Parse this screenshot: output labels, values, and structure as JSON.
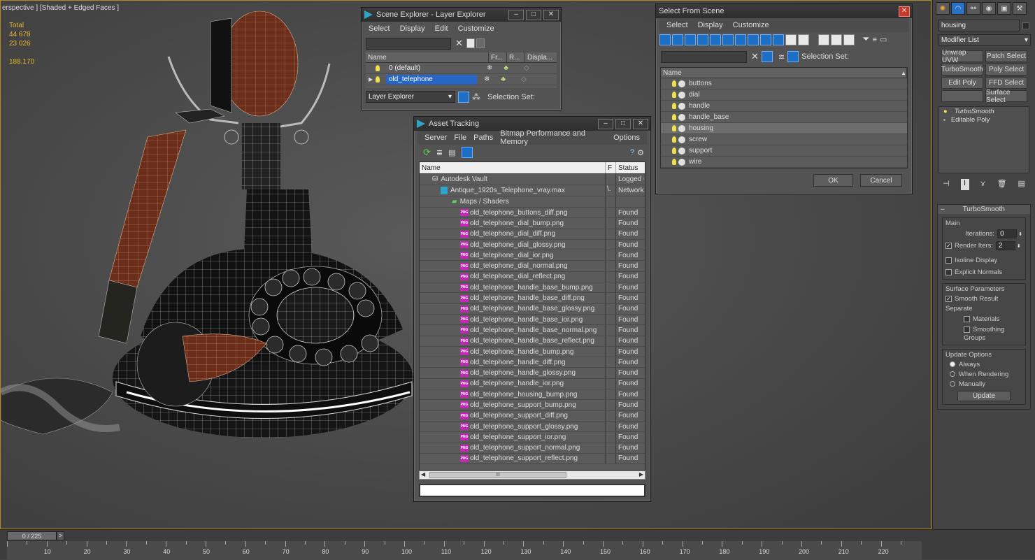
{
  "viewport": {
    "label": "erspective ] [Shaded + Edged Faces ]",
    "stats": {
      "total_label": "Total",
      "polys": "44 678",
      "verts": "23 026",
      "fps": "188.170"
    }
  },
  "scene_explorer": {
    "title": "Scene Explorer - Layer Explorer",
    "menu": [
      "Select",
      "Display",
      "Edit",
      "Customize"
    ],
    "columns": [
      "Name",
      "Fr...",
      "R...",
      "Displa..."
    ],
    "rows": [
      {
        "name": "0 (default)",
        "selected": false
      },
      {
        "name": "old_telephone",
        "selected": true
      }
    ],
    "dropdown": "Layer Explorer",
    "selection_set_label": "Selection Set:"
  },
  "asset_tracking": {
    "title": "Asset Tracking",
    "menu": [
      "Server",
      "File",
      "Paths",
      "Bitmap Performance and Memory",
      "Options"
    ],
    "columns": [
      "Name",
      "F",
      "Status"
    ],
    "vault": {
      "name": "Autodesk Vault",
      "status": "Logged C"
    },
    "scene_file": {
      "name": "Antique_1920s_Telephone_vray.max",
      "flag": "\\.",
      "status": "Network"
    },
    "group": "Maps / Shaders",
    "files": [
      {
        "name": "old_telephone_buttons_diff.png",
        "status": "Found"
      },
      {
        "name": "old_telephone_dial_bump.png",
        "status": "Found"
      },
      {
        "name": "old_telephone_dial_diff.png",
        "status": "Found"
      },
      {
        "name": "old_telephone_dial_glossy.png",
        "status": "Found"
      },
      {
        "name": "old_telephone_dial_ior.png",
        "status": "Found"
      },
      {
        "name": "old_telephone_dial_normal.png",
        "status": "Found"
      },
      {
        "name": "old_telephone_dial_reflect.png",
        "status": "Found"
      },
      {
        "name": "old_telephone_handle_base_bump.png",
        "status": "Found"
      },
      {
        "name": "old_telephone_handle_base_diff.png",
        "status": "Found"
      },
      {
        "name": "old_telephone_handle_base_glossy.png",
        "status": "Found"
      },
      {
        "name": "old_telephone_handle_base_ior.png",
        "status": "Found"
      },
      {
        "name": "old_telephone_handle_base_normal.png",
        "status": "Found"
      },
      {
        "name": "old_telephone_handle_base_reflect.png",
        "status": "Found"
      },
      {
        "name": "old_telephone_handle_bump.png",
        "status": "Found"
      },
      {
        "name": "old_telephone_handle_diff.png",
        "status": "Found"
      },
      {
        "name": "old_telephone_handle_glossy.png",
        "status": "Found"
      },
      {
        "name": "old_telephone_handle_ior.png",
        "status": "Found"
      },
      {
        "name": "old_telephone_housing_bump.png",
        "status": "Found"
      },
      {
        "name": "old_telephone_support_bump.png",
        "status": "Found"
      },
      {
        "name": "old_telephone_support_diff.png",
        "status": "Found"
      },
      {
        "name": "old_telephone_support_glossy.png",
        "status": "Found"
      },
      {
        "name": "old_telephone_support_ior.png",
        "status": "Found"
      },
      {
        "name": "old_telephone_support_normal.png",
        "status": "Found"
      },
      {
        "name": "old_telephone_support_reflect.png",
        "status": "Found"
      }
    ],
    "scroll_grip": "III"
  },
  "select_from_scene": {
    "title": "Select From Scene",
    "menu": [
      "Select",
      "Display",
      "Customize"
    ],
    "selection_set_label": "Selection Set:",
    "column": "Name",
    "objects": [
      {
        "name": "buttons",
        "selected": false
      },
      {
        "name": "dial",
        "selected": false
      },
      {
        "name": "handle",
        "selected": false
      },
      {
        "name": "handle_base",
        "selected": false
      },
      {
        "name": "housing",
        "selected": true
      },
      {
        "name": "screw",
        "selected": false
      },
      {
        "name": "support",
        "selected": false
      },
      {
        "name": "wire",
        "selected": false
      }
    ],
    "ok": "OK",
    "cancel": "Cancel"
  },
  "command_panel": {
    "object_name": "housing",
    "modifier_list": "Modifier List",
    "buttons": [
      "Unwrap UVW",
      "Patch Select",
      "TurboSmooth",
      "Poly Select",
      "Edit Poly",
      "FFD Select",
      "",
      "Surface Select"
    ],
    "stack": [
      "TurboSmooth",
      "Editable Poly"
    ],
    "rollout_title": "TurboSmooth",
    "main_label": "Main",
    "iterations_label": "Iterations:",
    "iterations_value": "0",
    "render_iters_label": "Render Iters:",
    "render_iters_value": "2",
    "isoline": "Isoline Display",
    "explicit_normals": "Explicit Normals",
    "surface_params": "Surface Parameters",
    "smooth_result": "Smooth Result",
    "separate": "Separate",
    "materials": "Materials",
    "smoothing_groups": "Smoothing Groups",
    "update_options": "Update Options",
    "always": "Always",
    "when_rendering": "When Rendering",
    "manually": "Manually",
    "update": "Update"
  },
  "timeline": {
    "frame": "0 / 225",
    "next": ">",
    "ticks": [
      "10",
      "20",
      "30",
      "40",
      "50",
      "60",
      "70",
      "80",
      "90",
      "100",
      "110",
      "120",
      "130",
      "140",
      "150",
      "160",
      "170",
      "180",
      "190",
      "200",
      "210",
      "220"
    ]
  }
}
